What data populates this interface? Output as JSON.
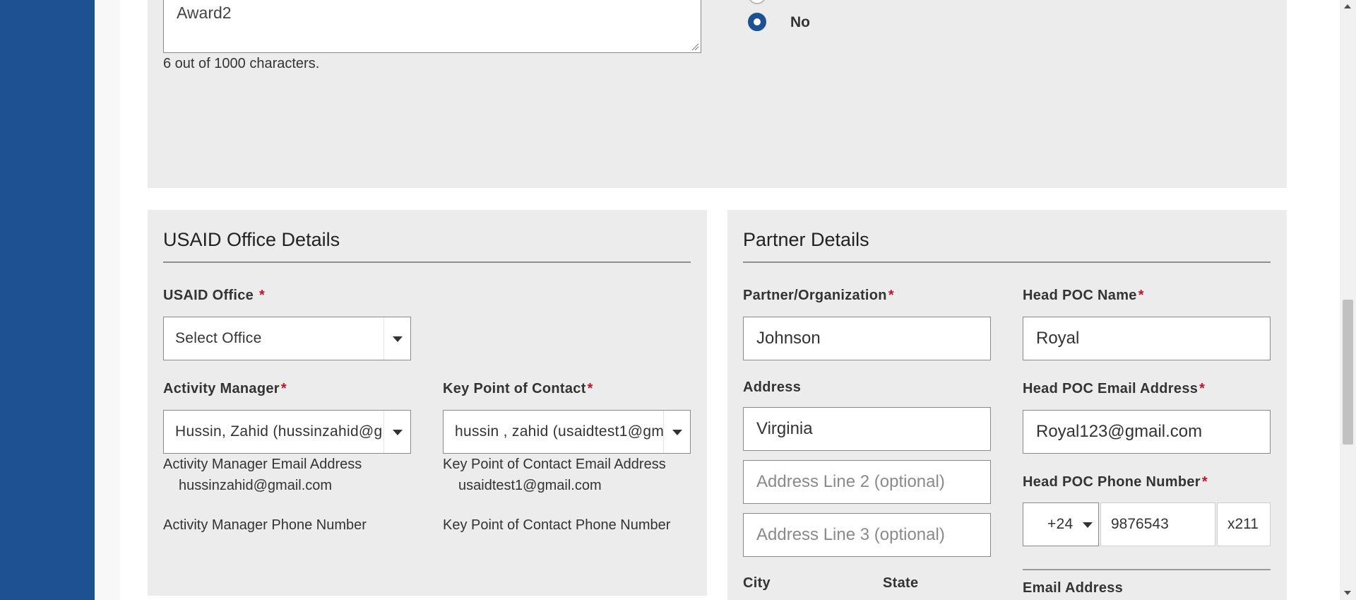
{
  "award_textarea": {
    "value": "Award2",
    "char_count": "6 out of 1000 characters."
  },
  "radio": {
    "no_label": "No"
  },
  "usaid_office_details": {
    "title": "USAID Office Details",
    "office": {
      "label": "USAID Office",
      "required_mark": "*",
      "selected": "Select Office"
    },
    "activity_manager": {
      "label": "Activity Manager",
      "required_mark": "*",
      "selected": "Hussin, Zahid (hussinzahid@g",
      "email_label": "Activity Manager Email Address",
      "email_value": "hussinzahid@gmail.com",
      "phone_label": "Activity Manager Phone Number"
    },
    "key_poc": {
      "label": "Key Point of Contact",
      "required_mark": "*",
      "selected": "hussin , zahid (usaidtest1@gm",
      "email_label": "Key Point of Contact Email Address",
      "email_value": "usaidtest1@gmail.com",
      "phone_label": "Key Point of Contact Phone Number"
    }
  },
  "partner_details": {
    "title": "Partner Details",
    "organization": {
      "label": "Partner/Organization",
      "required_mark": "*",
      "value": "Johnson"
    },
    "address": {
      "label": "Address",
      "line1": "Virginia",
      "line2_placeholder": "Address Line 2 (optional)",
      "line3_placeholder": "Address Line 3 (optional)"
    },
    "city_label": "City",
    "state_label": "State",
    "head_poc_name": {
      "label": "Head POC Name",
      "required_mark": "*",
      "value": "Royal"
    },
    "head_poc_email": {
      "label": "Head POC Email Address",
      "required_mark": "*",
      "value": "Royal123@gmail.com"
    },
    "head_poc_phone": {
      "label": "Head POC Phone Number",
      "required_mark": "*",
      "country_code": "+24",
      "number": "9876543",
      "extension": "x211"
    },
    "email_address_label": "Email Address"
  },
  "colors": {
    "sidebar": "#1e5192",
    "panel": "#ececec",
    "required": "#c0142b",
    "radio_selected": "#1e5192"
  }
}
